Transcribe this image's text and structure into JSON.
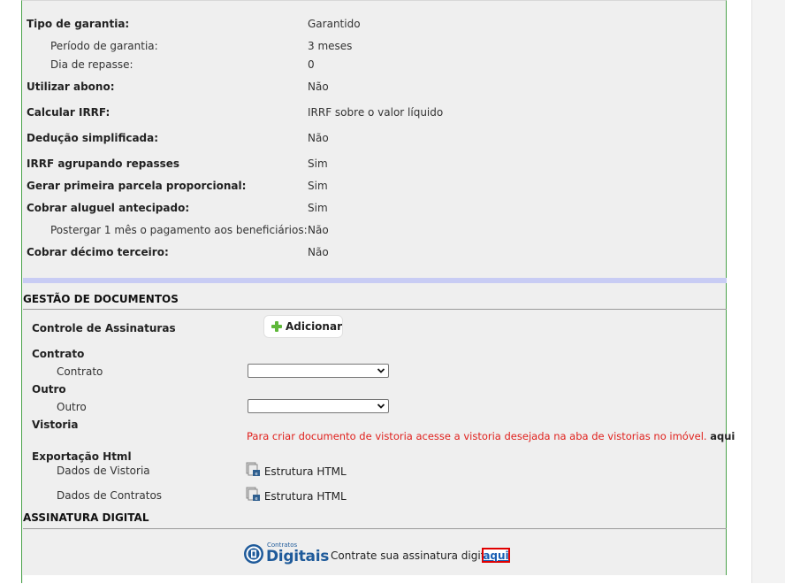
{
  "config": {
    "rows": [
      {
        "label": "Tipo de garantia:",
        "value": "Garantido"
      },
      {
        "label": "Período de garantia:",
        "value": "3 meses"
      },
      {
        "label": "Dia de repasse:",
        "value": "0"
      },
      {
        "label": "Utilizar abono:",
        "value": "Não"
      },
      {
        "label": "Calcular IRRF:",
        "value": "IRRF sobre o valor líquido"
      },
      {
        "label": "Dedução simplificada:",
        "value": "Não"
      },
      {
        "label": "IRRF agrupando repasses",
        "value": "Sim"
      },
      {
        "label": "Gerar primeira parcela proporcional:",
        "value": "Sim"
      },
      {
        "label": "Cobrar aluguel antecipado:",
        "value": "Sim"
      },
      {
        "label": "Postergar 1 mês o pagamento aos beneficiários:",
        "value": "Não"
      },
      {
        "label": "Cobrar décimo terceiro:",
        "value": "Não"
      }
    ]
  },
  "documentos": {
    "title": "GESTÃO DE DOCUMENTOS",
    "controle_label": "Controle de Assinaturas",
    "add_label": "Adicionar",
    "contrato_heading": "Contrato",
    "contrato_field_label": "Contrato",
    "contrato_selected": "",
    "outro_heading": "Outro",
    "outro_field_label": "Outro",
    "outro_selected": "",
    "vistoria_heading": "Vistoria",
    "vistoria_message": "Para criar documento de vistoria acesse a vistoria desejada na aba de vistorias no imóvel.",
    "vistoria_link": "aqui",
    "export_heading": "Exportação Html",
    "export_rows": [
      {
        "label": "Dados de Vistoria",
        "link": "Estrutura HTML"
      },
      {
        "label": "Dados de Contratos",
        "link": "Estrutura HTML"
      }
    ]
  },
  "assinatura": {
    "title": "ASSINATURA DIGITAL",
    "logo_small": "Contratos",
    "logo_big": "Digitais",
    "text": "Contrate sua assinatura digital",
    "link": "aqui"
  },
  "colors": {
    "panel_bg": "#efefef",
    "border_green": "#4aa24a",
    "section_band": "#c8ccf4",
    "warning_red": "#e0201c",
    "highlight_red": "#e00000",
    "link_blue": "#1a5fb4",
    "add_icon_green": "#5fb83a",
    "logo_blue": "#1e5a9a"
  }
}
